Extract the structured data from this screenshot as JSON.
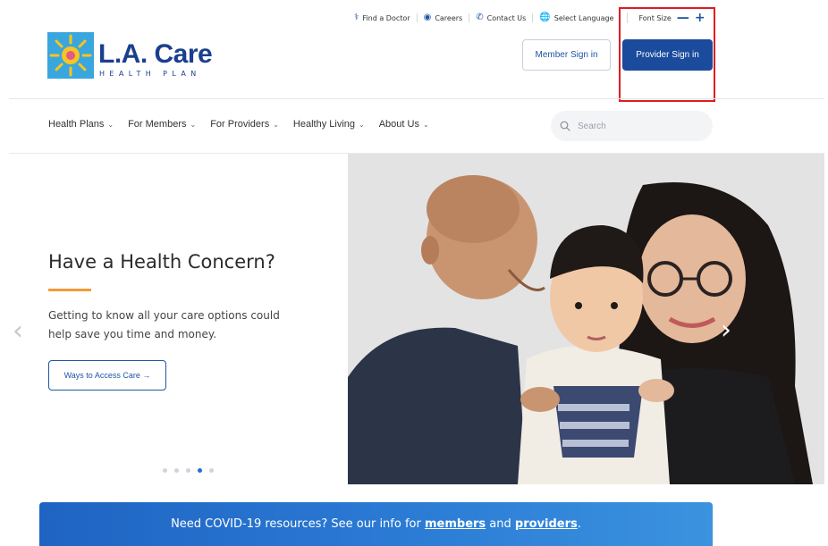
{
  "utility": {
    "find_doctor": "Find a Doctor",
    "careers": "Careers",
    "contact": "Contact Us",
    "language": "Select Language",
    "font_size_label": "Font Size",
    "font_minus": "—",
    "font_plus": "+"
  },
  "logo": {
    "brand": "L.A. Care",
    "tagline": "HEALTH PLAN"
  },
  "auth": {
    "member_sign_in": "Member Sign in",
    "provider_sign_in": "Provider Sign in"
  },
  "nav": {
    "items": [
      {
        "label": "Health Plans"
      },
      {
        "label": "For Members"
      },
      {
        "label": "For Providers"
      },
      {
        "label": "Healthy Living"
      },
      {
        "label": "About Us"
      }
    ],
    "chevron": "⌄"
  },
  "search": {
    "placeholder": "Search"
  },
  "hero": {
    "title": "Have a Health Concern?",
    "text": "Getting to know all your care options could help save you time and money.",
    "cta": "Ways to Access Care →",
    "prev": "‹",
    "next": "›",
    "slides_total": 5,
    "active_slide": 4
  },
  "banner": {
    "prefix": "Need COVID-19 resources? See our info for ",
    "members_link": "members",
    "middle": " and ",
    "providers_link": "providers",
    "suffix": "."
  },
  "colors": {
    "brand_blue": "#1a4b9c",
    "accent_orange": "#f29c38",
    "highlight_red": "#e01b22"
  }
}
